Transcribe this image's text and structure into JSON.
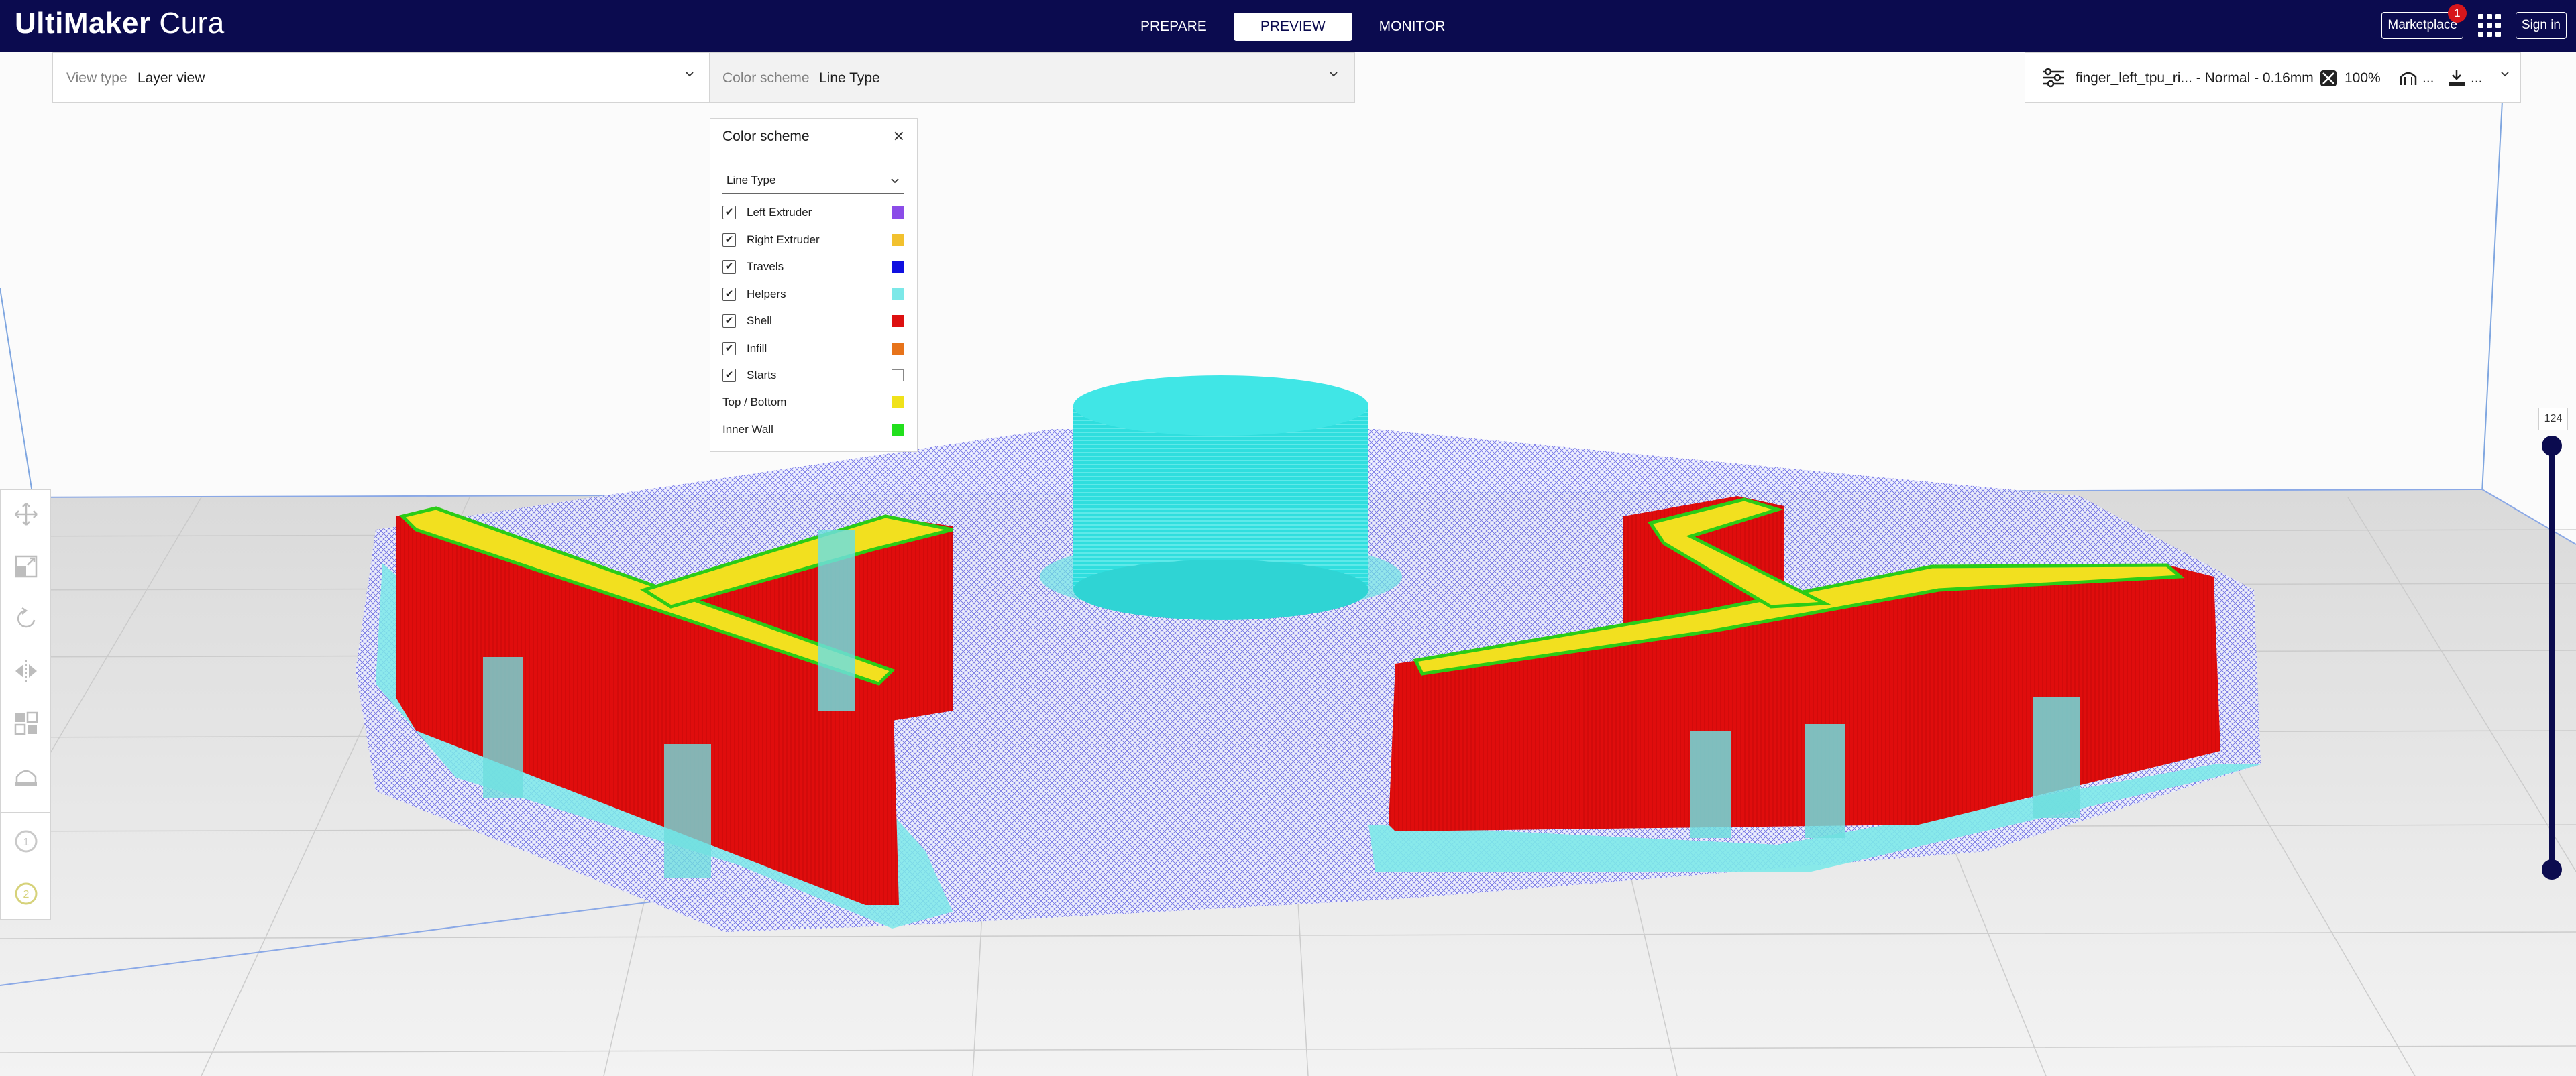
{
  "app": {
    "logo_bold": "UltiMaker",
    "logo_thin": "Cura",
    "stages": [
      "PREPARE",
      "PREVIEW",
      "MONITOR"
    ],
    "active_stage": "PREVIEW",
    "marketplace_label": "Marketplace",
    "marketplace_badge": "1",
    "signin_label": "Sign in"
  },
  "view_type": {
    "label": "View type",
    "value": "Layer view"
  },
  "color_scheme_bar": {
    "label": "Color scheme",
    "value": "Line Type"
  },
  "print_setup": {
    "profile": "finger_left_tpu_ri... - Normal - 0.16mm",
    "infill": "100%",
    "support": "...",
    "adhesion": "..."
  },
  "color_panel": {
    "title": "Color scheme",
    "selected": "Line Type",
    "items": [
      {
        "label": "Left Extruder",
        "checked": true,
        "color": "#8b4ce8"
      },
      {
        "label": "Right Extruder",
        "checked": true,
        "color": "#f2c12e"
      },
      {
        "label": "Travels",
        "checked": true,
        "color": "#1010e0"
      },
      {
        "label": "Helpers",
        "checked": true,
        "color": "#7ce8e8"
      },
      {
        "label": "Shell",
        "checked": true,
        "color": "#dd1010"
      },
      {
        "label": "Infill",
        "checked": true,
        "color": "#e7731a"
      },
      {
        "label": "Starts",
        "checked": true,
        "color": "#ffffff"
      },
      {
        "label": "Top / Bottom",
        "checked": null,
        "color": "#f0e21a"
      },
      {
        "label": "Inner Wall",
        "checked": null,
        "color": "#22e01d"
      }
    ]
  },
  "layer_slider": {
    "current_layer": "124"
  }
}
